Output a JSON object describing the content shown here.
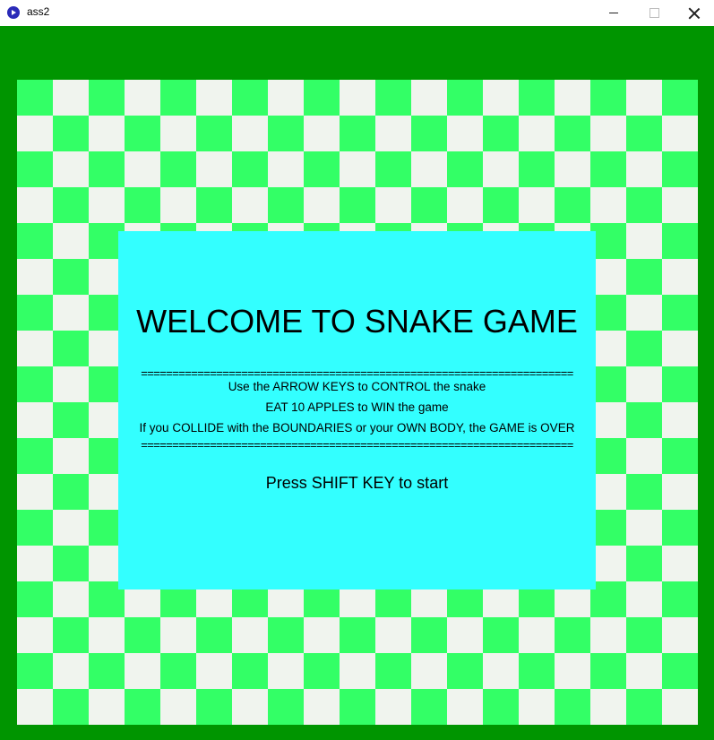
{
  "window": {
    "title": "ass2",
    "icon": "app-icon"
  },
  "colors": {
    "background": "#009500",
    "tile_light": "#f0f4ee",
    "tile_dark": "#33ff66",
    "menu_background": "#33ffff"
  },
  "menu": {
    "title": "WELCOME TO SNAKE GAME",
    "separator": "=====================================================================",
    "instructions": [
      "Use the ARROW KEYS to CONTROL the snake",
      "EAT 10 APPLES to WIN the game",
      "If you COLLIDE with the BOUNDARIES or your OWN BODY, the GAME is OVER"
    ],
    "start_prompt": "Press SHIFT KEY to start"
  }
}
